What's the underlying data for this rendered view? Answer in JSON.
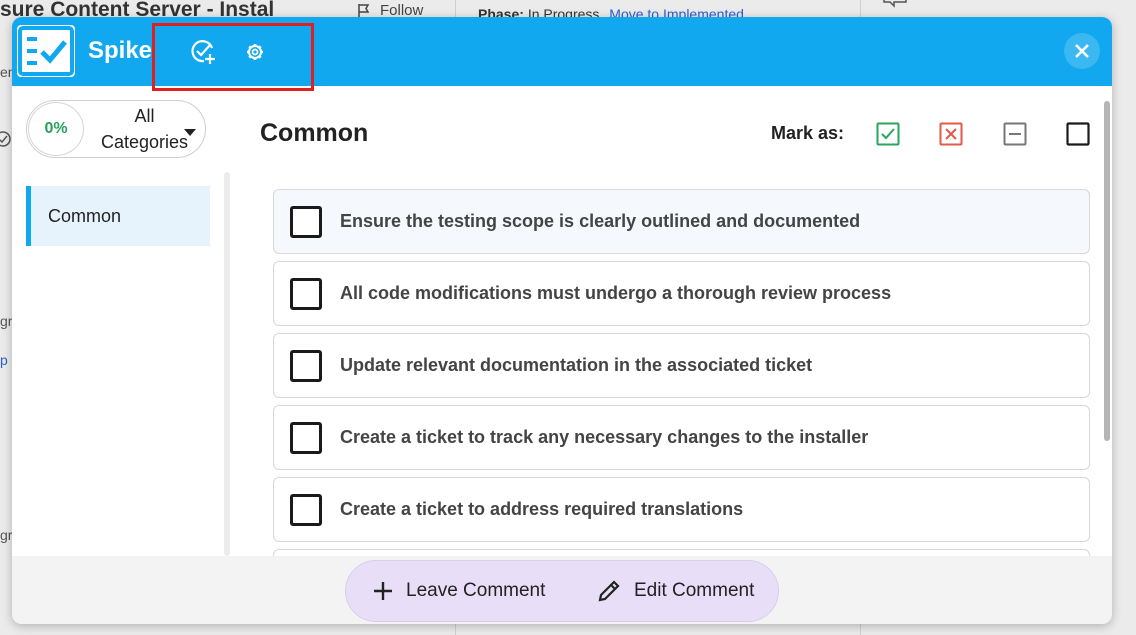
{
  "background": {
    "page_title": "sure Content Server - Instal",
    "follow_label": "Follow",
    "phase_label": "Phase:",
    "phase_value": "In Progress",
    "phase_link": "Move to Implemented",
    "left_snips": [
      "en",
      "gr",
      "p",
      "gr"
    ]
  },
  "modal": {
    "app_title": "Spike",
    "header_icons": [
      "add-check-icon",
      "settings-icon"
    ],
    "close_icon": "close-icon",
    "progress": "0%",
    "category_select": {
      "line1": "All",
      "line2": "Categories"
    },
    "categories": [
      {
        "label": "Common"
      }
    ],
    "section_title": "Common",
    "mark_as_label": "Mark as:",
    "mark_buttons": [
      {
        "name": "mark-done-icon",
        "color": "#2aa55c"
      },
      {
        "name": "mark-failed-icon",
        "color": "#e05a4a"
      },
      {
        "name": "mark-na-icon",
        "color": "#777777"
      },
      {
        "name": "mark-unchecked-icon",
        "color": "#1a1a1a"
      }
    ],
    "items": [
      {
        "text": "Ensure the testing scope is clearly outlined and documented"
      },
      {
        "text": "All code modifications must undergo a thorough review process"
      },
      {
        "text": "Update relevant documentation in the associated ticket"
      },
      {
        "text": "Create a ticket to track any necessary changes to the installer"
      },
      {
        "text": "Create a ticket to address required translations"
      }
    ],
    "footer": {
      "leave_comment": "Leave Comment",
      "edit_comment": "Edit Comment"
    }
  },
  "colors": {
    "header_bg": "#11a8ef",
    "accent": "#11a8ef",
    "progress_text": "#27a05a",
    "footer_pill": "#e8def8",
    "highlight": "#e02020"
  }
}
